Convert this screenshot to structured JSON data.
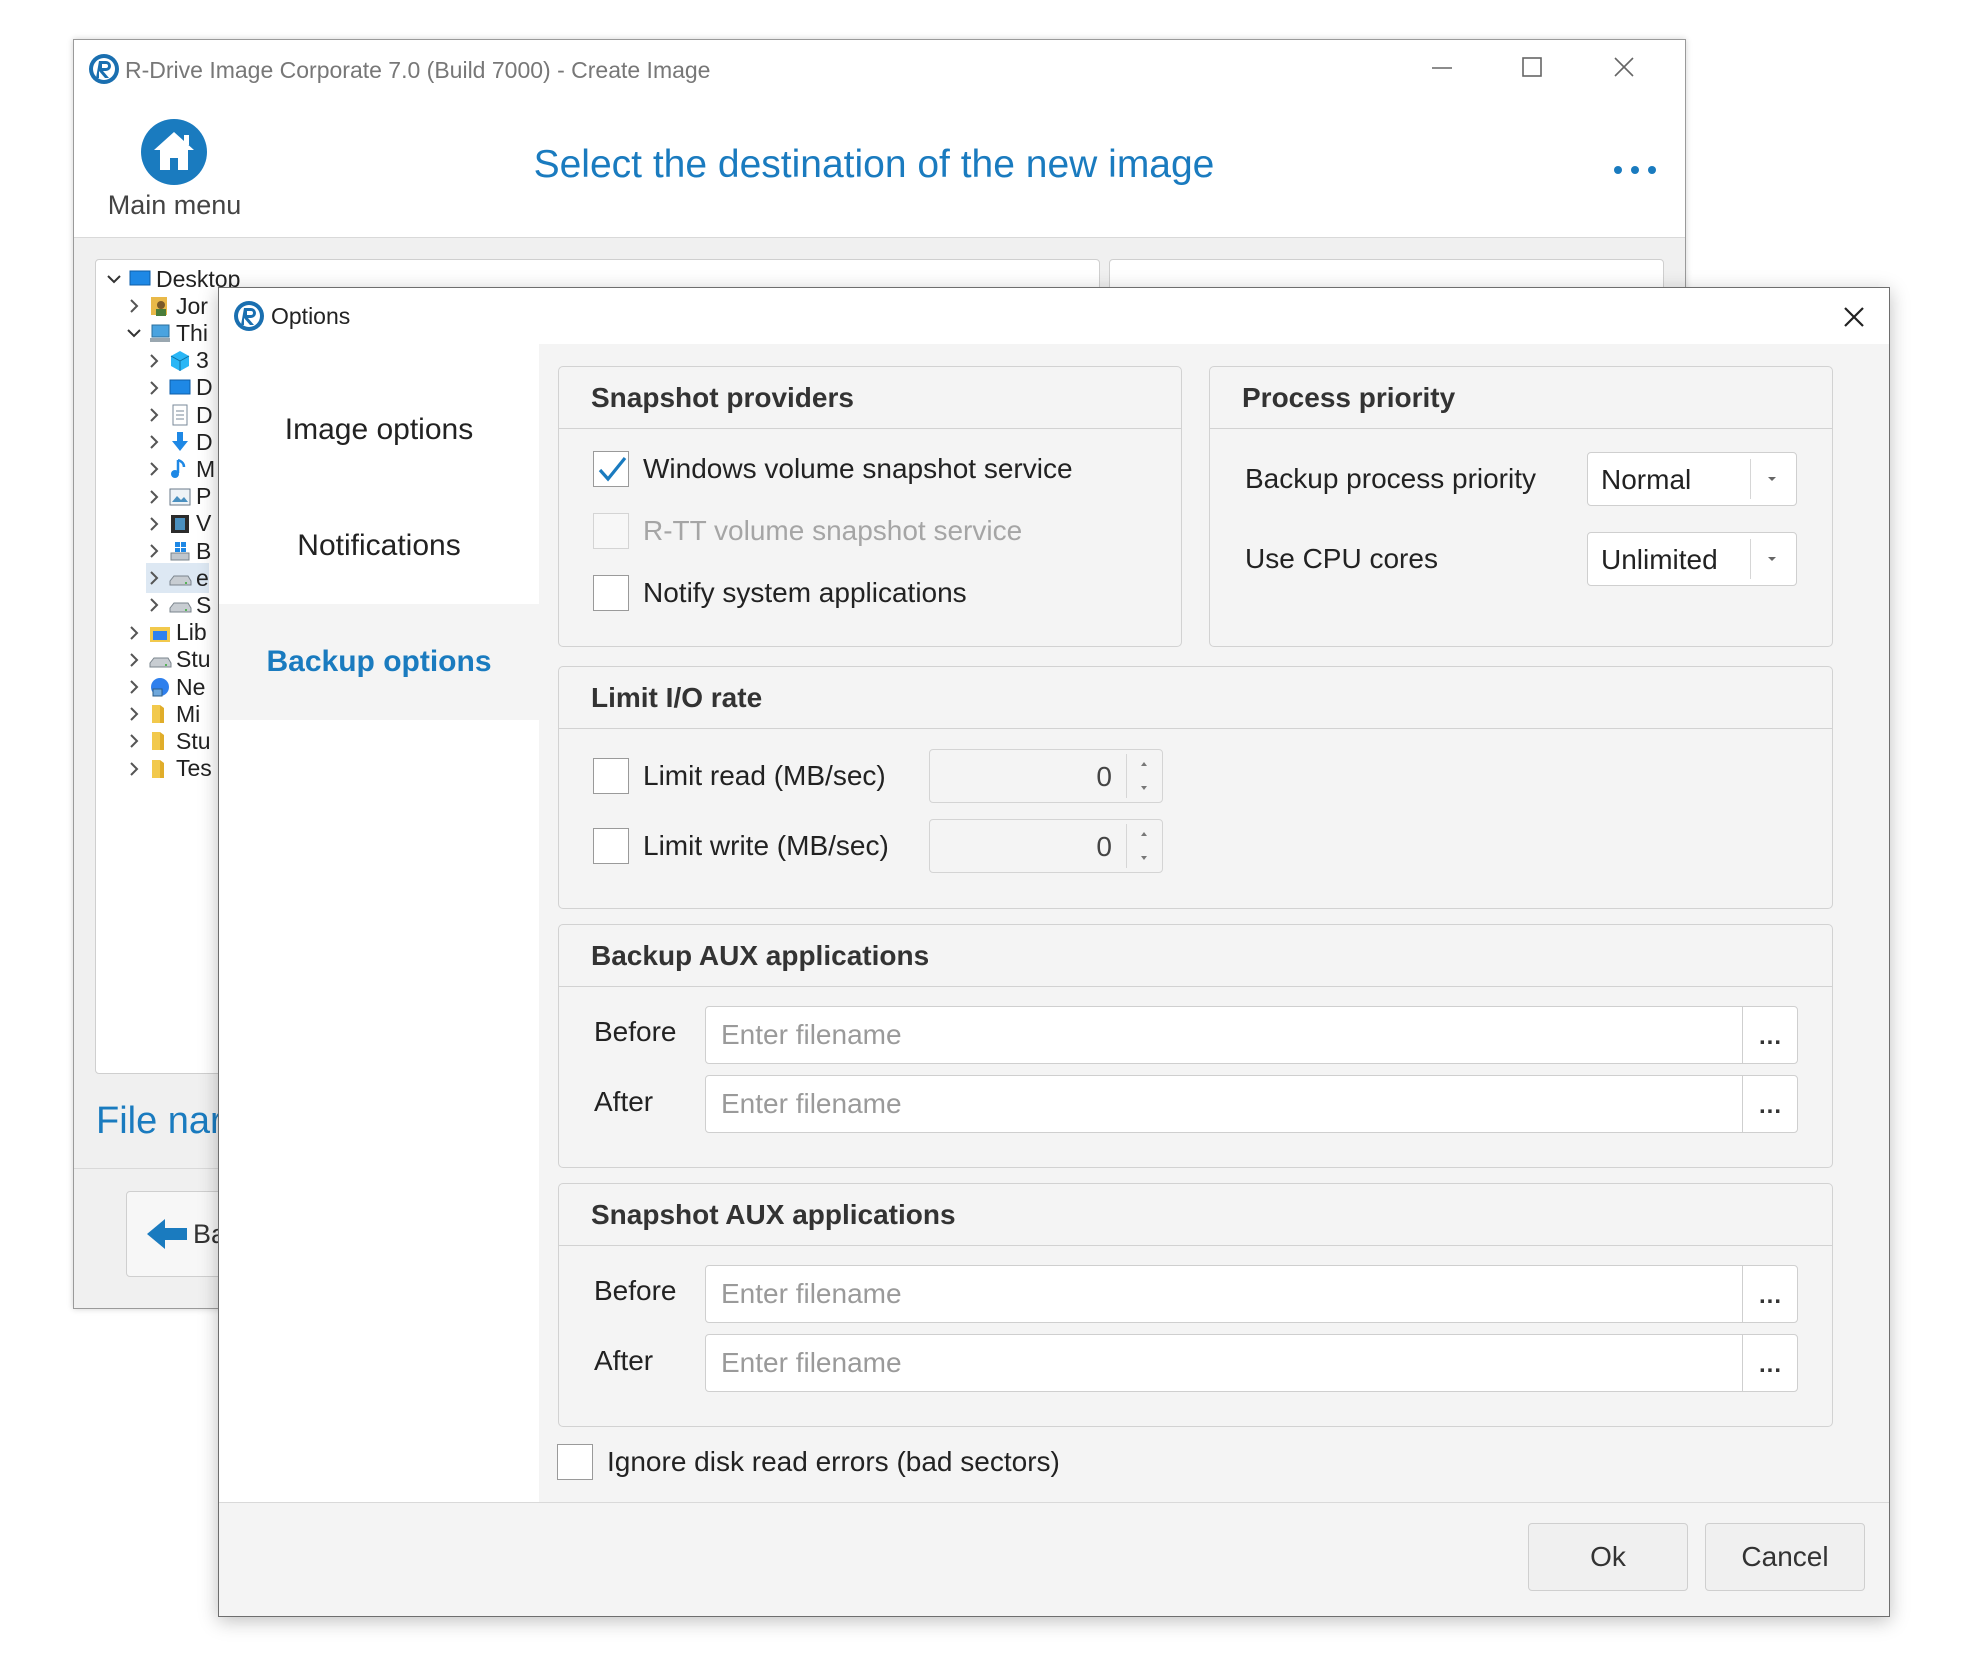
{
  "main_window": {
    "title": "R-Drive Image Corporate 7.0 (Build 7000) - Create Image",
    "main_menu_label": "Main menu",
    "page_title": "Select the destination of the new image",
    "file_name_label": "File nar",
    "back_label": "Ba",
    "tree": [
      {
        "label": "Desktop",
        "chevron": "down",
        "icon": "desktop-icon",
        "indent": 0
      },
      {
        "label": "Jor",
        "chevron": "right",
        "icon": "user-icon",
        "indent": 1
      },
      {
        "label": "Thi",
        "chevron": "down",
        "icon": "computer-icon",
        "indent": 1
      },
      {
        "label": "3",
        "chevron": "right",
        "icon": "3d-objects-icon",
        "indent": 2
      },
      {
        "label": "D",
        "chevron": "right",
        "icon": "desktop-icon",
        "indent": 2
      },
      {
        "label": "D",
        "chevron": "right",
        "icon": "documents-icon",
        "indent": 2
      },
      {
        "label": "D",
        "chevron": "right",
        "icon": "downloads-icon",
        "indent": 2
      },
      {
        "label": "M",
        "chevron": "right",
        "icon": "music-icon",
        "indent": 2
      },
      {
        "label": "P",
        "chevron": "right",
        "icon": "pictures-icon",
        "indent": 2
      },
      {
        "label": "V",
        "chevron": "right",
        "icon": "videos-icon",
        "indent": 2
      },
      {
        "label": "B",
        "chevron": "right",
        "icon": "windows-drive-icon",
        "indent": 2
      },
      {
        "label": "e",
        "chevron": "right",
        "icon": "drive-icon",
        "indent": 2,
        "selected": true
      },
      {
        "label": "S",
        "chevron": "right",
        "icon": "drive-icon",
        "indent": 2
      },
      {
        "label": "Lib",
        "chevron": "right",
        "icon": "libraries-icon",
        "indent": 1
      },
      {
        "label": "Stu",
        "chevron": "right",
        "icon": "drive-icon",
        "indent": 1
      },
      {
        "label": "Ne",
        "chevron": "right",
        "icon": "network-icon",
        "indent": 1
      },
      {
        "label": "Mi",
        "chevron": "right",
        "icon": "folder-icon",
        "indent": 1
      },
      {
        "label": "Stu",
        "chevron": "right",
        "icon": "folder-icon",
        "indent": 1
      },
      {
        "label": "Tes",
        "chevron": "right",
        "icon": "folder-icon",
        "indent": 1
      }
    ]
  },
  "dialog": {
    "title": "Options",
    "nav": {
      "image_options": "Image options",
      "notifications": "Notifications",
      "backup_options": "Backup options",
      "active": "backup_options"
    },
    "snapshot_providers": {
      "title": "Snapshot providers",
      "windows_vss": {
        "label": "Windows volume snapshot service",
        "checked": true,
        "enabled": true
      },
      "rtt_vss": {
        "label": "R-TT volume snapshot service",
        "checked": false,
        "enabled": false
      },
      "notify_apps": {
        "label": "Notify system applications",
        "checked": false,
        "enabled": true
      }
    },
    "process_priority": {
      "title": "Process priority",
      "backup_priority_label": "Backup process priority",
      "backup_priority_value": "Normal",
      "cpu_cores_label": "Use CPU cores",
      "cpu_cores_value": "Unlimited"
    },
    "limit_io": {
      "title": "Limit I/O rate",
      "read_label": "Limit read (MB/sec)",
      "read_checked": false,
      "read_value": "0",
      "write_label": "Limit write (MB/sec)",
      "write_checked": false,
      "write_value": "0"
    },
    "backup_aux": {
      "title": "Backup AUX applications",
      "before_label": "Before",
      "after_label": "After",
      "before_value": "",
      "after_value": "",
      "placeholder": "Enter filename",
      "browse_label": "..."
    },
    "snapshot_aux": {
      "title": "Snapshot AUX applications",
      "before_label": "Before",
      "after_label": "After",
      "before_value": "",
      "after_value": "",
      "placeholder": "Enter filename",
      "browse_label": "..."
    },
    "ignore_errors": {
      "label": "Ignore disk read errors (bad sectors)",
      "checked": false
    },
    "ok_label": "Ok",
    "cancel_label": "Cancel"
  },
  "colors": {
    "accent": "#1a7bbf",
    "dialog_bg": "#f4f4f4",
    "disabled_text": "#a5a5a5"
  }
}
